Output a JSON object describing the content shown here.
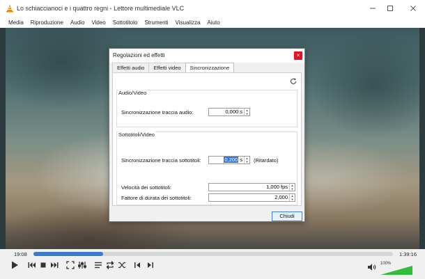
{
  "window": {
    "title": "Lo schiaccianoci e i quattro regni - Lettore multimediale VLC"
  },
  "menu": [
    "Media",
    "Riproduzione",
    "Audio",
    "Video",
    "Sottotitolo",
    "Strumenti",
    "Visualizza",
    "Aiuto"
  ],
  "dialog": {
    "title": "Regolazioni ed effetti",
    "close_symbol": "×",
    "tabs": [
      "Effetti audio",
      "Effetti video",
      "Sincronizzazione"
    ],
    "active_tab": 2,
    "audio_video": {
      "group_label": "Audio/Video",
      "audio_sync_label": "Sincronizzazione traccia audio:",
      "audio_sync_value": "0,000 s"
    },
    "subtitles": {
      "group_label": "Sottotitoli/Video",
      "sub_sync_label": "Sincronizzazione traccia sottotitoli:",
      "sub_sync_selected": "0,200",
      "sub_sync_unit": " s",
      "sub_sync_status": "(Ritardato)",
      "speed_label": "Velocità dei sottotitoli:",
      "speed_value": "1,000 fps",
      "duration_label": "Fattore di durata dei sottotitoli:",
      "duration_value": "2,000"
    },
    "close_button_label": "Chiudi"
  },
  "player": {
    "time_current": "19:08",
    "time_total": "1:39:16",
    "progress_fraction": 0.193,
    "volume_percent_label": "100%",
    "volume_fraction": 1.0,
    "accent_color": "#3b7bc9",
    "volume_color": "#2fbf3a"
  },
  "icons": {
    "app": "vlc-cone-icon",
    "refresh": "refresh-icon",
    "controls": [
      "play-icon",
      "previous-icon",
      "stop-icon",
      "next-icon",
      "fullscreen-icon",
      "extended-settings-icon",
      "playlist-icon",
      "loop-icon",
      "shuffle-icon",
      "frame-back-icon",
      "frame-forward-icon",
      "volume-icon"
    ]
  }
}
